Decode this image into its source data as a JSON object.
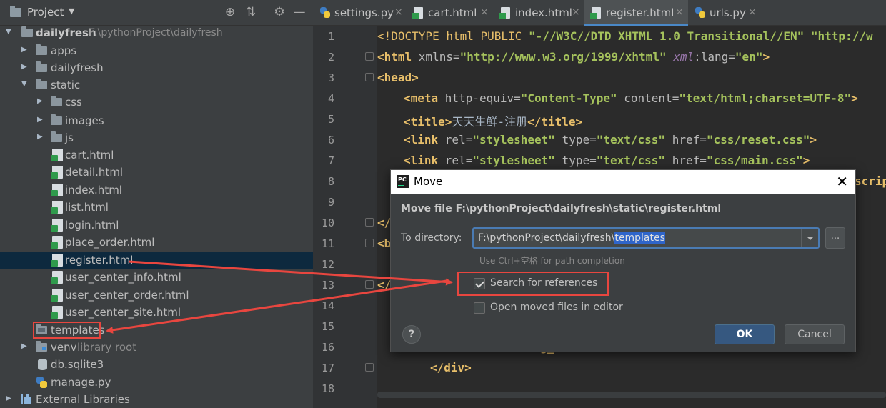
{
  "project_panel": {
    "title": "Project",
    "tree": {
      "root": {
        "label": "dailyfresh",
        "path": "F:\\pythonProject\\dailyfresh"
      },
      "apps": "apps",
      "dailyfresh_pkg": "dailyfresh",
      "static": "static",
      "css": "css",
      "images": "images",
      "js": "js",
      "files": [
        "cart.html",
        "detail.html",
        "index.html",
        "list.html",
        "login.html",
        "place_order.html",
        "register.html",
        "user_center_info.html",
        "user_center_order.html",
        "user_center_site.html"
      ],
      "templates": "templates",
      "venv": {
        "label": "venv",
        "note": "library root"
      },
      "db": "db.sqlite3",
      "manage": "manage.py",
      "external": "External Libraries"
    }
  },
  "editor": {
    "tabs": [
      {
        "label": "settings.py",
        "icon": "python-file-icon"
      },
      {
        "label": "cart.html",
        "icon": "html-file-icon"
      },
      {
        "label": "index.html",
        "icon": "html-file-icon"
      },
      {
        "label": "register.html",
        "icon": "html-file-icon",
        "active": true
      },
      {
        "label": "urls.py",
        "icon": "python-file-icon"
      }
    ],
    "line_numbers": [
      "1",
      "2",
      "3",
      "4",
      "5",
      "6",
      "7",
      "8",
      "9",
      "10",
      "11",
      "12",
      "13",
      "14",
      "15",
      "16",
      "17",
      "18"
    ],
    "code": {
      "l1_a": "<!DOCTYPE ",
      "l1_b": "html ",
      "l1_c": "PUBLIC ",
      "l1_d": "\"-//W3C//DTD XHTML 1.0 Transitional//EN\" ",
      "l1_e": "\"http://w",
      "l2_a": "<html ",
      "l2_b": "xmlns=",
      "l2_c": "\"http://www.w3.org/1999/xhtml\" ",
      "l2_d": "xml",
      "l2_e": ":lang=",
      "l2_f": "\"en\"",
      "l2_g": ">",
      "l3": "<head>",
      "l4_a": "<meta ",
      "l4_b": "http-equiv=",
      "l4_c": "\"Content-Type\" ",
      "l4_d": "content=",
      "l4_e": "\"text/html;charset=UTF-8\"",
      "l4_f": ">",
      "l5_a": "<title>",
      "l5_b": "天天生鲜-注册",
      "l5_c": "</title>",
      "l6_a": "<link ",
      "l6_b": "rel=",
      "l6_c": "\"stylesheet\" ",
      "l6_d": "type=",
      "l6_e": "\"text/css\" ",
      "l6_f": "href=",
      "l6_g": "\"css/reset.css\"",
      "l6_h": ">",
      "l7_a": "<link ",
      "l7_b": "rel=",
      "l7_c": "\"stylesheet\" ",
      "l7_d": "type=",
      "l7_e": "\"text/css\" ",
      "l7_f": "href=",
      "l7_g": "\"css/main.css\"",
      "l7_h": ">",
      "l8_tail": "scrip",
      "l10": "</",
      "l11": "<b",
      "l13": "</",
      "l16": "g_",
      "l17": "</div>"
    }
  },
  "move_dialog": {
    "title": "Move",
    "description": "Move file F:\\pythonProject\\dailyfresh\\static\\register.html",
    "to_directory_label": "To directory:",
    "directory_prefix": "F:\\pythonProject\\dailyfresh\\",
    "directory_selected": "templates",
    "browse_label": "...",
    "hint": "Use Ctrl+空格 for path completion",
    "search_references": {
      "label": "Search for references",
      "checked": true
    },
    "open_moved": {
      "label": "Open moved files in editor",
      "checked": false
    },
    "help_label": "?",
    "ok_label": "OK",
    "cancel_label": "Cancel"
  },
  "colors": {
    "annotation_red": "#e8463f",
    "selection_blue": "#2f65ca",
    "accent_blue": "#4a88c7"
  }
}
